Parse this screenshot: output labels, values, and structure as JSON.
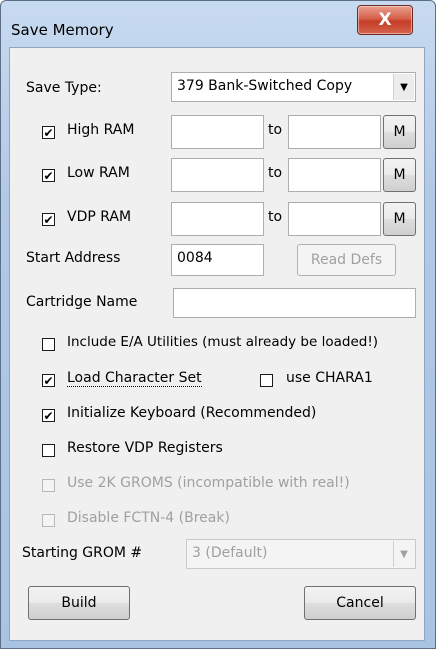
{
  "window": {
    "title": "Save Memory",
    "close_glyph": "X"
  },
  "save_type": {
    "label": "Save Type:",
    "value": "379 Bank-Switched Copy"
  },
  "ram_rows": [
    {
      "label": "High RAM",
      "checked": true,
      "from": "",
      "to_label": "to",
      "to": "",
      "m_label": "M"
    },
    {
      "label": "Low RAM",
      "checked": true,
      "from": "",
      "to_label": "to",
      "to": "",
      "m_label": "M"
    },
    {
      "label": "VDP RAM",
      "checked": true,
      "from": "",
      "to_label": "to",
      "to": "",
      "m_label": "M"
    }
  ],
  "start_address": {
    "label": "Start Address",
    "value": "0084",
    "read_defs_label": "Read Defs"
  },
  "cartridge_name": {
    "label": "Cartridge Name",
    "value": ""
  },
  "options": {
    "include_ea": {
      "label": "Include E/A Utilities (must already be loaded!)",
      "checked": false
    },
    "load_charset": {
      "label": "Load Character Set",
      "checked": true
    },
    "use_chara1": {
      "label": "use CHARA1",
      "checked": false
    },
    "init_keyboard": {
      "label": "Initialize Keyboard (Recommended)",
      "checked": true
    },
    "restore_vdp": {
      "label": "Restore VDP Registers",
      "checked": false
    },
    "use_2k_groms": {
      "label": "Use 2K GROMS (incompatible with real!)",
      "checked": false
    },
    "disable_fctn4": {
      "label": "Disable FCTN-4 (Break)",
      "checked": false
    }
  },
  "starting_grom": {
    "label": "Starting GROM #",
    "value": "3 (Default)"
  },
  "buttons": {
    "build": "Build",
    "cancel": "Cancel"
  },
  "icons": {
    "check_glyph": "✔",
    "dropdown_glyph": "▼"
  }
}
